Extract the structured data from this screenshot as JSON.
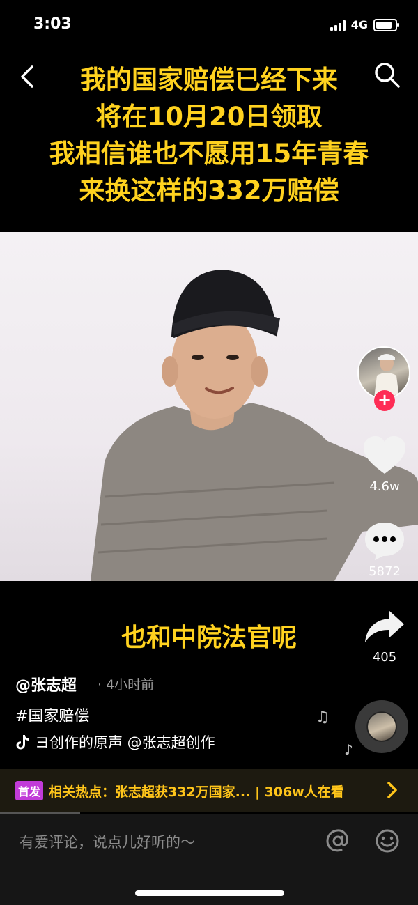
{
  "status": {
    "time": "3:03",
    "network": "4G"
  },
  "caption": {
    "lines": [
      "我的国家赔偿已经下来",
      "将在10月20日领取",
      "我相信谁也不愿用15年青春",
      "来换这样的332万赔偿"
    ]
  },
  "video": {
    "subtitle": "也和中院法官呢"
  },
  "rail": {
    "likes": "4.6w",
    "comments": "5872",
    "shares": "405",
    "follow_label": "+"
  },
  "post": {
    "author": "@张志超",
    "time": "· 4小时前",
    "hashtag": "#国家赔偿",
    "music": "ヨ创作的原声    @张志超创作"
  },
  "hot": {
    "badge": "首发",
    "text": "相关热点：张志超获332万国家... | 306w人在看"
  },
  "comment": {
    "placeholder": "有爱评论，说点儿好听的～"
  },
  "colors": {
    "caption": "#ffd21f",
    "follow": "#fe2c55",
    "hot_badge": "#c13bd8",
    "hot_text": "#ffc51a"
  },
  "icons": [
    "back-icon",
    "search-icon",
    "heart-icon",
    "comment-icon",
    "share-icon",
    "music-note-icon",
    "at-icon",
    "emoji-icon",
    "chevron-right-icon"
  ]
}
